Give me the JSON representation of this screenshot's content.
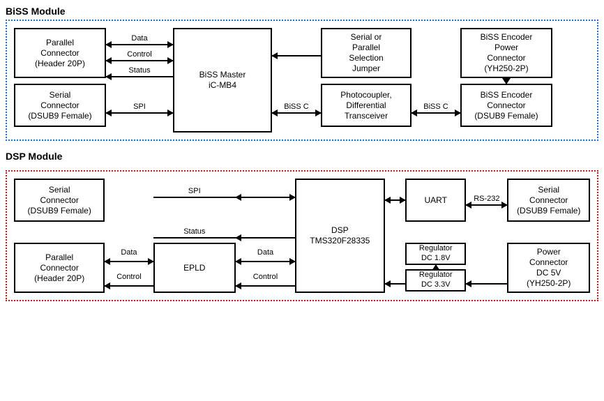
{
  "biss": {
    "title": "BiSS Module",
    "parallel_conn": "Parallel\nConnector\n(Header 20P)",
    "serial_conn": "Serial\nConnector\n(DSUB9 Female)",
    "master": "BiSS Master\niC-MB4",
    "jumper": "Serial or\nParallel\nSelection\nJumper",
    "photo": "Photocoupler,\nDifferential\nTransceiver",
    "enc_power": "BiSS Encoder\nPower\nConnector\n(YH250-2P)",
    "enc_conn": "BiSS Encoder\nConnector\n(DSUB9 Female)",
    "labels": {
      "data": "Data",
      "control": "Control",
      "status": "Status",
      "spi": "SPI",
      "biss_c": "BiSS C"
    }
  },
  "dsp": {
    "title": "DSP Module",
    "serial_conn_left": "Serial\nConnector\n(DSUB9 Female)",
    "parallel_conn": "Parallel\nConnector\n(Header 20P)",
    "epld": "EPLD",
    "dsp": "DSP\nTMS320F28335",
    "uart": "UART",
    "serial_conn_right": "Serial\nConnector\n(DSUB9 Female)",
    "reg18": "Regulator\nDC 1.8V",
    "reg33": "Regulator\nDC 3.3V",
    "power": "Power\nConnector\nDC 5V\n(YH250-2P)",
    "labels": {
      "spi": "SPI",
      "status": "Status",
      "data": "Data",
      "control": "Control",
      "rs232": "RS-232"
    }
  },
  "chart_data": {
    "type": "diagram",
    "modules": [
      {
        "name": "BiSS Module",
        "blocks": [
          "Parallel Connector (Header 20P)",
          "Serial Connector (DSUB9 Female)",
          "BiSS Master iC-MB4",
          "Serial or Parallel Selection Jumper",
          "Photocoupler, Differential Transceiver",
          "BiSS Encoder Power Connector (YH250-2P)",
          "BiSS Encoder Connector (DSUB9 Female)"
        ],
        "edges": [
          {
            "from": "Parallel Connector (Header 20P)",
            "to": "BiSS Master iC-MB4",
            "label": "Data",
            "dir": "both"
          },
          {
            "from": "Parallel Connector (Header 20P)",
            "to": "BiSS Master iC-MB4",
            "label": "Control",
            "dir": "both"
          },
          {
            "from": "BiSS Master iC-MB4",
            "to": "Parallel Connector (Header 20P)",
            "label": "Status",
            "dir": "one"
          },
          {
            "from": "Serial Connector (DSUB9 Female)",
            "to": "BiSS Master iC-MB4",
            "label": "SPI",
            "dir": "both"
          },
          {
            "from": "Serial or Parallel Selection Jumper",
            "to": "BiSS Master iC-MB4",
            "label": "",
            "dir": "one"
          },
          {
            "from": "BiSS Master iC-MB4",
            "to": "Photocoupler, Differential Transceiver",
            "label": "BiSS C",
            "dir": "both"
          },
          {
            "from": "Photocoupler, Differential Transceiver",
            "to": "BiSS Encoder Connector (DSUB9 Female)",
            "label": "BiSS C",
            "dir": "both"
          },
          {
            "from": "BiSS Encoder Power Connector (YH250-2P)",
            "to": "BiSS Encoder Connector (DSUB9 Female)",
            "label": "",
            "dir": "one"
          }
        ]
      },
      {
        "name": "DSP Module",
        "blocks": [
          "Serial Connector (DSUB9 Female) [left]",
          "Parallel Connector (Header 20P)",
          "EPLD",
          "DSP TMS320F28335",
          "UART",
          "Serial Connector (DSUB9 Female) [right]",
          "Regulator DC 1.8V",
          "Regulator DC 3.3V",
          "Power Connector DC 5V (YH250-2P)"
        ],
        "edges": [
          {
            "from": "Serial Connector (DSUB9 Female) [left]",
            "to": "DSP TMS320F28335",
            "label": "SPI",
            "dir": "both"
          },
          {
            "from": "DSP TMS320F28335",
            "to": "Parallel Connector (Header 20P)",
            "label": "Status",
            "dir": "one"
          },
          {
            "from": "Parallel Connector (Header 20P)",
            "to": "EPLD",
            "label": "Data",
            "dir": "both"
          },
          {
            "from": "EPLD",
            "to": "Parallel Connector (Header 20P)",
            "label": "Control",
            "dir": "one"
          },
          {
            "from": "EPLD",
            "to": "DSP TMS320F28335",
            "label": "Data",
            "dir": "both"
          },
          {
            "from": "DSP TMS320F28335",
            "to": "EPLD",
            "label": "Control",
            "dir": "one"
          },
          {
            "from": "DSP TMS320F28335",
            "to": "UART",
            "label": "",
            "dir": "both"
          },
          {
            "from": "UART",
            "to": "Serial Connector (DSUB9 Female) [right]",
            "label": "RS-232",
            "dir": "both"
          },
          {
            "from": "Power Connector DC 5V (YH250-2P)",
            "to": "Regulator DC 3.3V",
            "label": "",
            "dir": "one"
          },
          {
            "from": "Regulator DC 3.3V",
            "to": "Regulator DC 1.8V",
            "label": "",
            "dir": "one"
          },
          {
            "from": "Regulator DC 3.3V",
            "to": "DSP TMS320F28335",
            "label": "",
            "dir": "one"
          }
        ]
      }
    ]
  }
}
